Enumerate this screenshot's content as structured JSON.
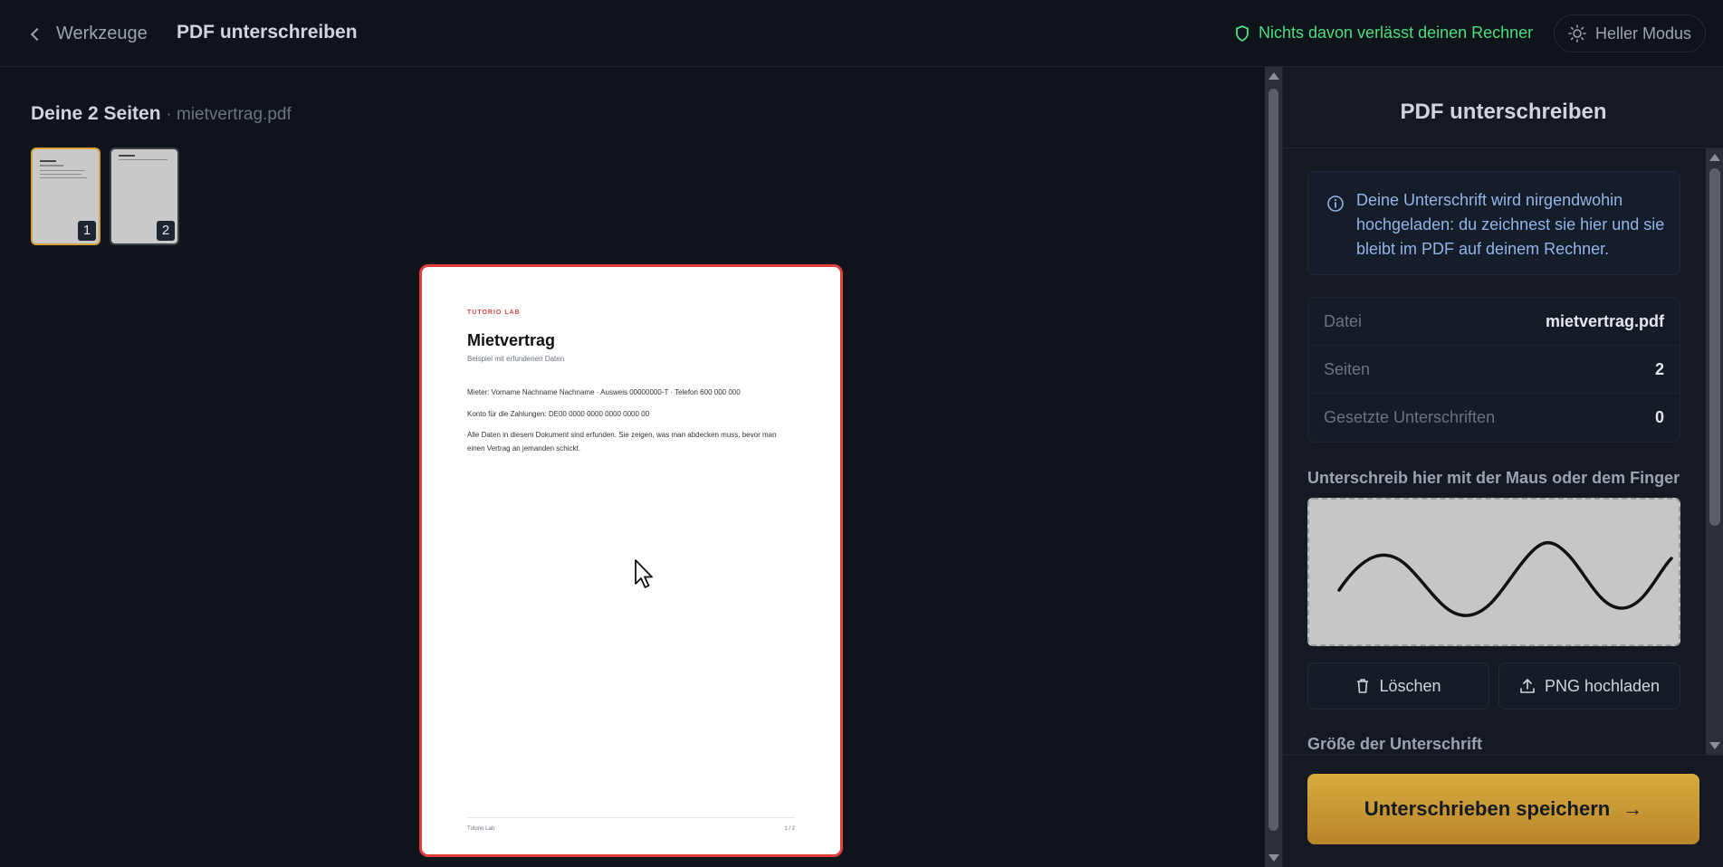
{
  "topbar": {
    "back_label": "Werkzeuge",
    "title": "PDF unterschreiben",
    "privacy_text": "Nichts davon verlässt deinen Rechner",
    "mode_label": "Heller Modus"
  },
  "workspace": {
    "heading": "Deine 2 Seiten",
    "filename": "· mietvertrag.pdf",
    "thumbnails": [
      {
        "number": "1",
        "selected": true
      },
      {
        "number": "2",
        "selected": false
      }
    ],
    "document": {
      "brand": "TUTORIO LAB",
      "title": "Mietvertrag",
      "subtitle": "Beispiel mit erfundenen Daten",
      "line1": "Mieter: Vorname Nachname Nachname · Ausweis 00000000-T · Telefon 600 000 000",
      "line2": "Konto für die Zahlungen: DE00 0000 0000 0000 0000 00",
      "line3": "Alle Daten in diesem Dokument sind erfunden. Sie zeigen, was man abdecken muss, bevor man einen Vertrag an jemanden schickt.",
      "footer_left": "Tutorio Lab",
      "footer_right": "1 / 2"
    }
  },
  "panel": {
    "title": "PDF unterschreiben",
    "info": "Deine Unterschrift wird nirgendwohin hochgeladen: du zeichnest sie hier und sie bleibt im PDF auf deinem Rechner.",
    "stats": [
      {
        "label": "Datei",
        "value": "mietvertrag.pdf"
      },
      {
        "label": "Seiten",
        "value": "2"
      },
      {
        "label": "Gesetzte Unterschriften",
        "value": "0"
      }
    ],
    "draw_label": "Unterschreib hier mit der Maus oder dem Finger",
    "clear_label": "Löschen",
    "upload_label": "PNG hochladen",
    "size_label": "Größe der Unterschrift",
    "save_label": "Unterschrieben speichern"
  },
  "colors": {
    "accent": "#d6a33a",
    "privacy_green": "#4ade80",
    "page_outline": "#e23d3d"
  }
}
